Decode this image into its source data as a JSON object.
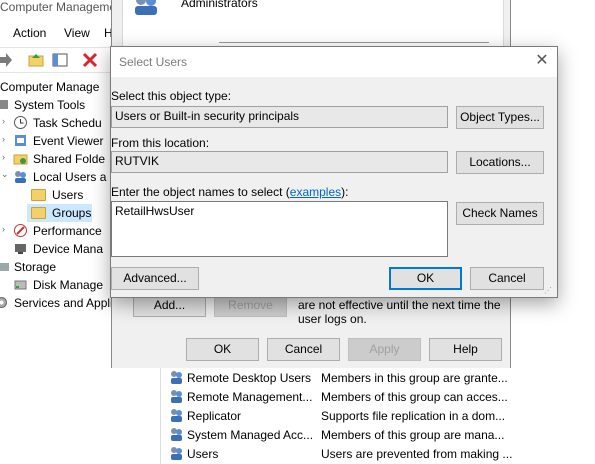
{
  "mmc": {
    "title": "Computer Manageme",
    "menu": [
      "Action",
      "View",
      "H"
    ],
    "tree": [
      {
        "label": "Computer Manage",
        "icon": "computer-icon"
      },
      {
        "label": "System Tools",
        "icon": "tools-icon"
      },
      {
        "label": "Task Schedu",
        "icon": "clock-icon"
      },
      {
        "label": "Event Viewer",
        "icon": "event-viewer-icon"
      },
      {
        "label": "Shared Folde",
        "icon": "shared-folder-icon"
      },
      {
        "label": "Local Users a",
        "icon": "users-icon"
      },
      {
        "label": "Users",
        "icon": "folder-icon"
      },
      {
        "label": "Groups",
        "icon": "folder-icon"
      },
      {
        "label": "Performance",
        "icon": "performance-icon"
      },
      {
        "label": "Device Mana",
        "icon": "device-manager-icon"
      },
      {
        "label": "Storage",
        "icon": "storage-icon"
      },
      {
        "label": "Disk Manage",
        "icon": "disk-icon"
      },
      {
        "label": "Services and Appli",
        "icon": "services-icon"
      }
    ]
  },
  "props": {
    "members_header": "Administrators",
    "add_label": "Add...",
    "remove_label": "Remove",
    "note_line1": "are not effective until the next time the",
    "note_line2": "user logs on.",
    "ok_label": "OK",
    "cancel_label": "Cancel",
    "apply_label": "Apply",
    "help_label": "Help"
  },
  "groups_list": [
    {
      "name": "Remote Desktop Users",
      "desc": "Members in this group are grante..."
    },
    {
      "name": "Remote Management...",
      "desc": "Members of this group can acces..."
    },
    {
      "name": "Replicator",
      "desc": "Supports file replication in a dom..."
    },
    {
      "name": "System Managed Acc...",
      "desc": "Members of this group are mana..."
    },
    {
      "name": "Users",
      "desc": "Users are prevented from making ..."
    }
  ],
  "dialog": {
    "title": "Select Users",
    "object_type_label": "Select this object type:",
    "object_type_value": "Users or Built-in security principals",
    "object_types_button": "Object Types...",
    "location_label": "From this location:",
    "location_value": "RUTVIK",
    "locations_button": "Locations...",
    "names_label_prefix": "Enter the object names to select (",
    "names_label_link": "examples",
    "names_label_suffix": "):",
    "names_value": "RetailHwsUser",
    "check_names_button": "Check Names",
    "advanced_button": "Advanced...",
    "ok_button": "OK",
    "cancel_button": "Cancel"
  }
}
